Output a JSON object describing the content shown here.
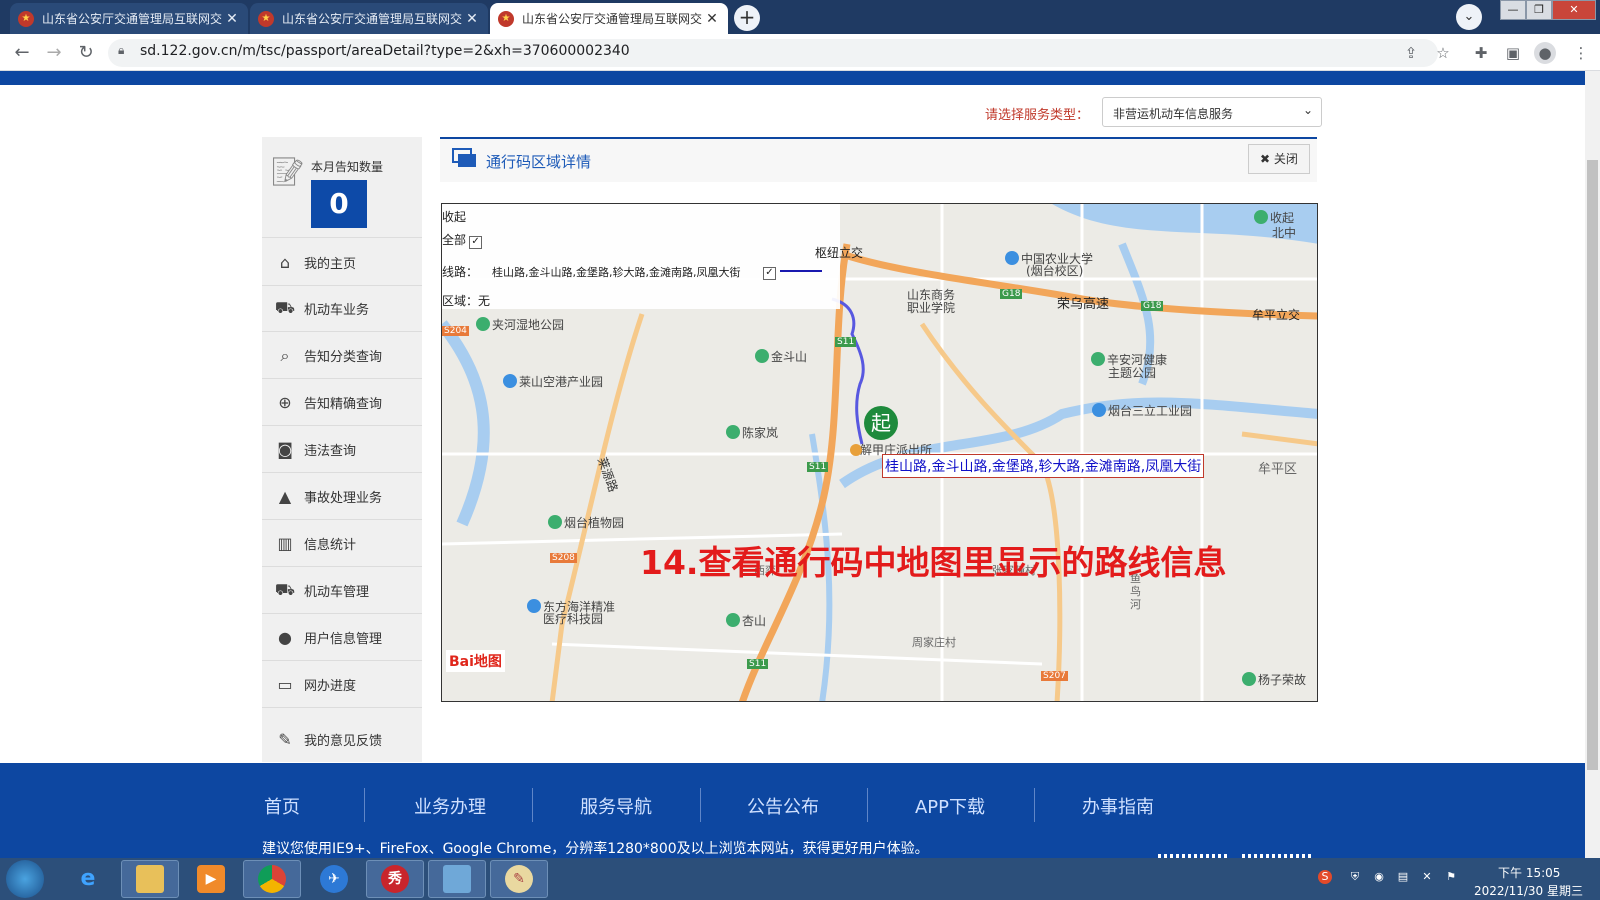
{
  "browser": {
    "tabs": [
      {
        "title": "山东省公安厅交通管理局互联网交"
      },
      {
        "title": "山东省公安厅交通管理局互联网交"
      },
      {
        "title": "山东省公安厅交通管理局互联网交"
      }
    ],
    "url": "sd.122.gov.cn/m/tsc/passport/areaDetail?type=2&xh=370600002340"
  },
  "service": {
    "label": "请选择服务类型：",
    "selected": "非营运机动车信息服务"
  },
  "sidebar": {
    "notice_label": "本月告知数量",
    "notice_count": "0",
    "items": [
      {
        "label": "我的主页",
        "icon": "home-icon"
      },
      {
        "label": "机动车业务",
        "icon": "truck-icon"
      },
      {
        "label": "告知分类查询",
        "icon": "search-icon"
      },
      {
        "label": "告知精确查询",
        "icon": "zoom-search-icon"
      },
      {
        "label": "违法查询",
        "icon": "camera-icon"
      },
      {
        "label": "事故处理业务",
        "icon": "warning-icon"
      },
      {
        "label": "信息统计",
        "icon": "bar-chart-icon"
      },
      {
        "label": "机动车管理",
        "icon": "truck-icon"
      },
      {
        "label": "用户信息管理",
        "icon": "user-icon"
      },
      {
        "label": "网办进度",
        "icon": "progress-icon"
      },
      {
        "label": "我的意见反馈",
        "icon": "feedback-icon"
      }
    ]
  },
  "content": {
    "title": "通行码区域详情",
    "close_label": "关闭"
  },
  "map": {
    "panel": {
      "collapse": "收起",
      "all_label": "全部",
      "route_prefix": "线路：",
      "route_text": "桂山路,金斗山路,金堡路,轸大路,金滩南路,凤凰大街",
      "area_label": "区域：无"
    },
    "route_label": "桂山路,金斗山路,金堡路,轸大路,金滩南路,凤凰大街",
    "start_marker": "起",
    "places": {
      "p1": "枢纽立交",
      "p2": "中国农业大学",
      "p3": "(烟台校区)",
      "p4": "山东商务",
      "p5": "职业学院",
      "p6": "荣乌高速",
      "p7": "牟平立交",
      "p8": "夹河湿地公园",
      "p9": "金斗山",
      "p10": "辛安河健康",
      "p11": "主题公园",
      "p12": "莱山空港产业园",
      "p13": "烟台三立工业园",
      "p14": "陈家岚",
      "p15": "解甲庄派出所",
      "p16": "牟平区",
      "p17": "莱源路",
      "p18": "烟台植物园",
      "p19": "东方海洋精准",
      "p20": "医疗科技园",
      "p21": "杏山",
      "p22": "周家庄村",
      "p23": "杨子荣故",
      "p24": "收起",
      "p25": "北中",
      "p26": "张家疃村",
      "p27": "鱼鸟河",
      "p28": "西弈"
    },
    "highway_shields": [
      "G18",
      "G18",
      "S11",
      "S11",
      "S11",
      "S204",
      "S208",
      "S207"
    ],
    "logo_text": "Bai地图",
    "colors": {
      "route": "#5858e0",
      "highway": "#f2a65a",
      "water": "#a8cdf0"
    }
  },
  "annotation": "14.查看通行码中地图里显示的路线信息",
  "footer": {
    "nav": [
      "首页",
      "业务办理",
      "服务导航",
      "公告公布",
      "APP下载",
      "办事指南"
    ],
    "note": "建议您使用IE9+、FireFox、Google Chrome，分辨率1280*800及以上浏览本网站，获得更好用户体验。"
  },
  "taskbar": {
    "time": "下午 15:05",
    "date": "2022/11/30 星期三"
  }
}
